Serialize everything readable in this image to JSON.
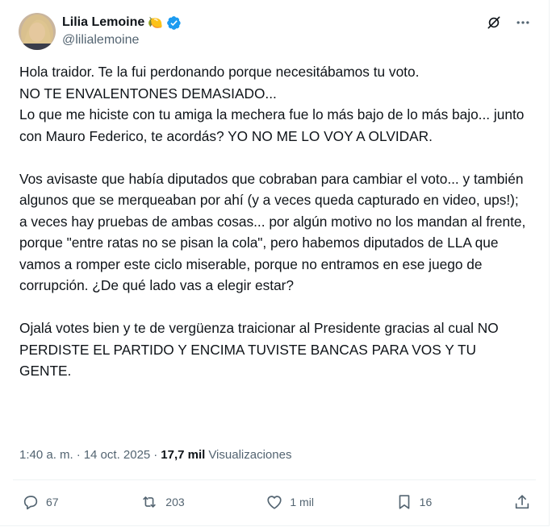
{
  "author": {
    "display_name": "Lilia Lemoine",
    "handle": "@lilialemoine",
    "emoji": "🍋",
    "verified_color": "#1d9bf0"
  },
  "tweet": {
    "paragraphs": [
      "Hola traidor. Te la fui perdonando porque necesitábamos tu voto.\nNO TE ENVALENTONES DEMASIADO...\nLo que me hiciste con tu amiga la mechera fue lo más bajo de lo más bajo... junto con Mauro Federico, te acordás? YO NO ME LO VOY A OLVIDAR.",
      "Vos avisaste que había diputados que cobraban para cambiar el voto... y también algunos que se merqueaban por ahí (y a veces queda capturado en video, ups!); a veces hay pruebas de ambas cosas... por algún motivo no los mandan al frente, porque \"entre ratas no se pisan la cola\", pero habemos diputados de LLA que vamos a romper este ciclo miserable, porque no entramos en ese juego de corrupción. ¿De qué lado vas a elegir estar?",
      "Ojalá votes bien y te de vergüenza traicionar al Presidente gracias al cual NO PERDISTE EL PARTIDO Y ENCIMA TUVISTE BANCAS PARA VOS Y TU GENTE."
    ]
  },
  "meta": {
    "time": "1:40 a. m.",
    "separator": "·",
    "date": "14 oct. 2025",
    "separator2": "·",
    "views_count": "17,7 mil",
    "views_label": "Visualizaciones"
  },
  "actions": {
    "replies": "67",
    "reposts": "203",
    "likes": "1 mil",
    "bookmarks": "16"
  },
  "icons": {
    "top_left": "grok-icon",
    "top_right": "more-icon",
    "reply": "reply-icon",
    "repost": "repost-icon",
    "like": "heart-icon",
    "bookmark": "bookmark-icon",
    "share": "share-icon"
  },
  "colors": {
    "text": "#0f1419",
    "secondary": "#536471",
    "verified": "#1d9bf0"
  }
}
